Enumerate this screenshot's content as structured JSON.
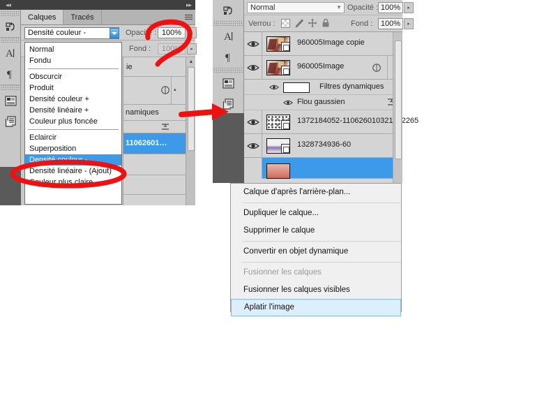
{
  "app": {
    "name": "Adobe Photoshop",
    "language": "fr",
    "accent_selection": "#3d9ae8",
    "annotation_color": "#ee1111",
    "panel_bg": "#d4d4d4"
  },
  "left_panel": {
    "tabs": [
      {
        "label": "Calques",
        "active": true
      },
      {
        "label": "Tracés",
        "active": false
      }
    ],
    "menu_icon": "hamburger-icon",
    "collapse_left_icon": "◂◂",
    "collapse_right_icon": "▸▸",
    "blend_mode": {
      "label": "",
      "value": "Densité couleur -",
      "dropdown_icon": "chevron-down-icon",
      "open": true
    },
    "opacity": {
      "label": "Opacité :",
      "value": "100%",
      "spinner_icon": "▸"
    },
    "fill": {
      "label": "Fond :",
      "value": "100%",
      "spinner_icon": "▸",
      "disabled": true
    },
    "blend_modes": [
      {
        "label": "Normal",
        "selected": false,
        "separator_after": false
      },
      {
        "label": "Fondu",
        "selected": false,
        "separator_after": true
      },
      {
        "label": "Obscurcir",
        "selected": false,
        "separator_after": false
      },
      {
        "label": "Produit",
        "selected": false,
        "separator_after": false
      },
      {
        "label": "Densité couleur +",
        "selected": false,
        "separator_after": false
      },
      {
        "label": "Densité linéaire +",
        "selected": false,
        "separator_after": false
      },
      {
        "label": "Couleur plus foncée",
        "selected": false,
        "separator_after": true
      },
      {
        "label": "Eclaircir",
        "selected": false,
        "separator_after": false
      },
      {
        "label": "Superposition",
        "selected": false,
        "separator_after": false
      },
      {
        "label": "Densité couleur -",
        "selected": true,
        "separator_after": false
      },
      {
        "label": "Densité linéaire - (Ajout)",
        "selected": false,
        "separator_after": false
      },
      {
        "label": "Couleur plus claire",
        "selected": false,
        "separator_after": false
      }
    ],
    "partial_layers": [
      {
        "text": "ie",
        "selected": false
      },
      {
        "text": "",
        "selected": false
      },
      {
        "text": "namiques",
        "selected": false
      },
      {
        "text": "",
        "selected": false
      },
      {
        "text": "11062601…",
        "selected": true
      },
      {
        "text": "",
        "selected": false
      }
    ],
    "toolbar_icons": [
      "history-brush-icon",
      "type-tool-icon",
      "paragraph-icon",
      "layer-comp-icon",
      "layers-panel-icon"
    ]
  },
  "right_panel": {
    "blend_mode": {
      "value": "Normal",
      "dropdown_icon": "chevron-down-icon"
    },
    "opacity": {
      "label": "Opacité :",
      "value": "100%",
      "spinner_icon": "▸"
    },
    "fill": {
      "label": "Fond :",
      "value": "100%",
      "spinner_icon": "▸"
    },
    "lock": {
      "label": "Verrou :",
      "icons": [
        "lock-transparency-icon",
        "lock-image-icon",
        "lock-position-icon",
        "lock-all-icon"
      ]
    },
    "layers": [
      {
        "name": "960005Image copie",
        "visible": true,
        "visibility_icon": "eye-icon",
        "thumbnail": "portrait-thumb",
        "selected": false,
        "has_fx": false,
        "children": []
      },
      {
        "name": "960005Image",
        "visible": true,
        "visibility_icon": "eye-icon",
        "thumbnail": "portrait-thumb",
        "selected": false,
        "has_fx": true,
        "fx_icon": "smart-filter-icon",
        "collapse_icon": "▴",
        "children": [
          {
            "name": "Filtres dynamiques",
            "visible": true,
            "visibility_icon": "eye-icon",
            "swatch": "white-mask"
          },
          {
            "name": "Flou gaussien",
            "visible": true,
            "visibility_icon": "eye-icon",
            "options_icon": "filter-options-icon"
          }
        ]
      },
      {
        "name": "1372184052-110626010321652265",
        "visible": true,
        "visibility_icon": "eye-icon",
        "thumbnail": "confetti-thumb",
        "selected": false,
        "has_fx": false,
        "children": []
      },
      {
        "name": "1328734936-60",
        "visible": true,
        "visibility_icon": "eye-icon",
        "thumbnail": "purple-thumb",
        "selected": false,
        "has_fx": false,
        "children": []
      },
      {
        "name": "",
        "visible": false,
        "visibility_icon": "eye-icon",
        "thumbnail": "red-thumb",
        "selected": true,
        "has_fx": false,
        "children": []
      }
    ],
    "toolbar_icons": [
      "history-brush-icon",
      "type-tool-icon",
      "paragraph-icon",
      "layer-comp-icon",
      "layers-panel-icon"
    ]
  },
  "context_menu": {
    "items": [
      {
        "label": "Calque d'après l'arrière-plan...",
        "disabled": false,
        "highlighted": false,
        "separator_after": true
      },
      {
        "label": "Dupliquer le calque...",
        "disabled": false,
        "highlighted": false,
        "separator_after": false
      },
      {
        "label": "Supprimer le calque",
        "disabled": false,
        "highlighted": false,
        "separator_after": true
      },
      {
        "label": "Convertir en objet dynamique",
        "disabled": false,
        "highlighted": false,
        "separator_after": true
      },
      {
        "label": "Fusionner les calques",
        "disabled": true,
        "highlighted": false,
        "separator_after": false
      },
      {
        "label": "Fusionner les calques visibles",
        "disabled": false,
        "highlighted": false,
        "separator_after": false
      },
      {
        "label": "Aplatir l'image",
        "disabled": false,
        "highlighted": true,
        "separator_after": false
      }
    ]
  },
  "annotations": [
    {
      "name": "opacity-circle",
      "shape": "ellipse-scribble",
      "target": "opacity field"
    },
    {
      "name": "blend-mode-item-circle",
      "shape": "ellipse-scribble",
      "target": "Densité couleur - item"
    },
    {
      "name": "panel-arrow",
      "shape": "arrow-right",
      "target": "layers panel icon"
    }
  ]
}
